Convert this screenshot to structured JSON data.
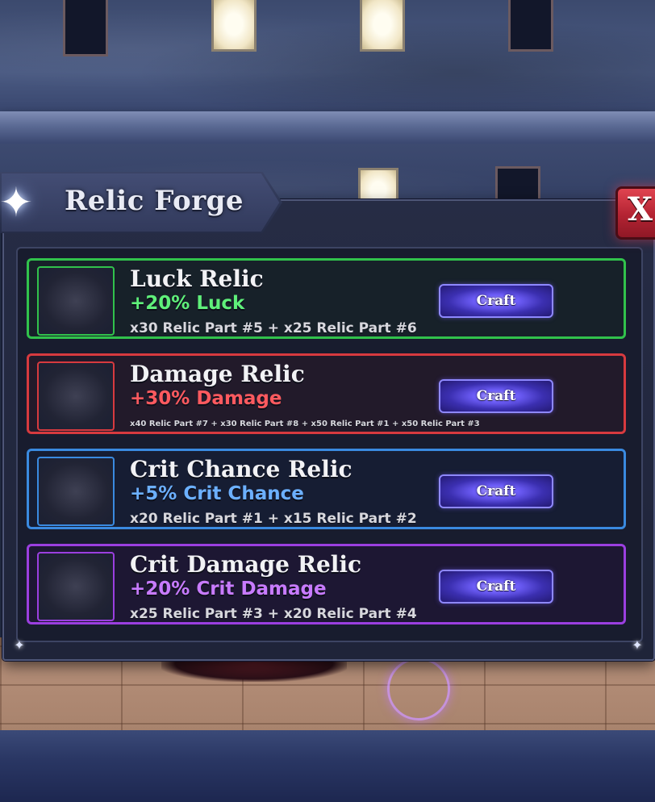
{
  "title": "Relic Forge",
  "close_label": "X",
  "relics": [
    {
      "name": "Luck Relic",
      "bonus": "+20% Luck",
      "cost": "x30 Relic Part #5 + x25 Relic Part #6",
      "craft_label": "Craft",
      "accent": "#31c24c",
      "bonus_color": "#5ff07a",
      "bg": "#172129"
    },
    {
      "name": "Damage Relic",
      "bonus": "+30% Damage",
      "cost": "x40 Relic Part #7 + x30 Relic Part #8 + x50 Relic Part #1 + x50 Relic Part #3",
      "craft_label": "Craft",
      "accent": "#d73a3f",
      "bonus_color": "#ff5a5f",
      "bg": "#221a2a"
    },
    {
      "name": "Crit Chance Relic",
      "bonus": "+5% Crit Chance",
      "cost": "x20 Relic Part #1 + x15 Relic Part #2",
      "craft_label": "Craft",
      "accent": "#3a8ae0",
      "bonus_color": "#6cb0ff",
      "bg": "#161d33"
    },
    {
      "name": "Crit Damage Relic",
      "bonus": "+20% Crit Damage",
      "cost": "x25 Relic Part #3 + x20 Relic Part #4",
      "craft_label": "Craft",
      "accent": "#9b3fe0",
      "bonus_color": "#c87bff",
      "bg": "#1d1733"
    }
  ]
}
